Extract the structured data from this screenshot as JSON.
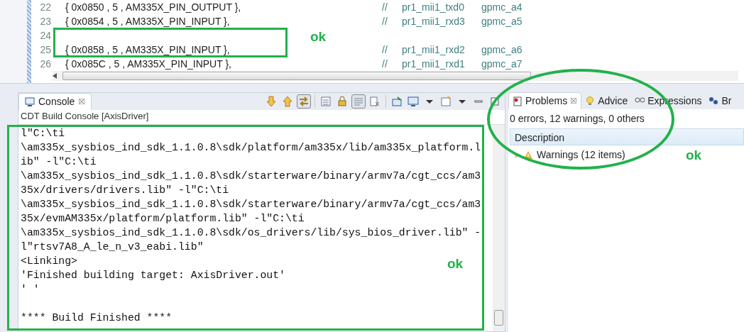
{
  "editor": {
    "lines": [
      {
        "number": "22",
        "code": "{ 0x0850 , 5 , AM335X_PIN_OUTPUT },",
        "comment": "//",
        "signal": "pr1_mii1_txd0",
        "pin": "gpmc_a4"
      },
      {
        "number": "23",
        "code": "{ 0x0854 , 5 , AM335X_PIN_INPUT },",
        "comment": "//",
        "signal": "pr1_mii1_rxd3",
        "pin": "gpmc_a5"
      },
      {
        "number": "24"
      },
      {
        "number": "25",
        "code": "{ 0x0858 , 5 , AM335X_PIN_INPUT },",
        "comment": "//",
        "signal": "pr1_mii1_rxd2",
        "pin": "gpmc_a6"
      },
      {
        "number": "26",
        "code": "{ 0x085C , 5 , AM335X_PIN_INPUT },",
        "comment": "//",
        "signal": "pr1_mii1_rxd1",
        "pin": "gpmc_a7"
      }
    ]
  },
  "console": {
    "tab": {
      "label": "Console",
      "selected": true,
      "close": "☒"
    },
    "toolbar": [
      {
        "kind": "down",
        "pressed": false
      },
      {
        "kind": "up",
        "pressed": false
      },
      {
        "kind": "link",
        "pressed": true
      },
      {
        "kind": "sep"
      },
      {
        "kind": "page",
        "pressed": false
      },
      {
        "kind": "lock",
        "pressed": false
      },
      {
        "kind": "lines",
        "pressed": true
      },
      {
        "kind": "clear",
        "pressed": false
      },
      {
        "kind": "sep"
      },
      {
        "kind": "pin",
        "pressed": false
      },
      {
        "kind": "monitor",
        "pressed": false
      },
      {
        "kind": "caret",
        "pressed": false
      },
      {
        "kind": "window",
        "pressed": false
      },
      {
        "kind": "caret",
        "pressed": false
      },
      {
        "kind": "min",
        "pressed": false
      },
      {
        "kind": "max",
        "pressed": false
      }
    ],
    "title": "CDT Build Console [AxisDriver]",
    "lines": [
      "l\"C:\\ti",
      "\\am335x_sysbios_ind_sdk_1.1.0.8\\sdk/platform/am335x/lib/am335x_platform.l",
      "ib\" -l\"C:\\ti",
      "\\am335x_sysbios_ind_sdk_1.1.0.8\\sdk/starterware/binary/armv7a/cgt_ccs/am3",
      "35x/drivers/drivers.lib\" -l\"C:\\ti",
      "\\am335x_sysbios_ind_sdk_1.1.0.8\\sdk/starterware/binary/armv7a/cgt_ccs/am3",
      "35x/evmAM335x/platform/platform.lib\" -l\"C:\\ti",
      "\\am335x_sysbios_ind_sdk_1.1.0.8\\sdk/os_drivers/lib/sys_bios_driver.lib\" -",
      "l\"rtsv7A8_A_le_n_v3_eabi.lib\"",
      "<Linking>",
      "'Finished building target: AxisDriver.out'",
      "' '"
    ],
    "footer": "**** Build Finished ****"
  },
  "problems": {
    "tabs": [
      {
        "label": "Problems",
        "kind": "problems",
        "selected": true,
        "close": "☒"
      },
      {
        "label": "Advice",
        "kind": "advice",
        "selected": false
      },
      {
        "label": "Expressions",
        "kind": "expressions",
        "selected": false
      },
      {
        "label": "Br",
        "kind": "breakpoints",
        "selected": false
      }
    ],
    "summary": "0 errors, 12 warnings, 0 others",
    "column": "Description",
    "rows": [
      {
        "label": "Warnings (12 items)",
        "expanded": false
      }
    ]
  },
  "annotations": [
    {
      "kind": "rect"
    },
    {
      "kind": "rect"
    },
    {
      "kind": "ellipse"
    },
    {
      "kind": "text",
      "text": "ok"
    },
    {
      "kind": "text",
      "text": "ok"
    },
    {
      "kind": "text",
      "text": "ok"
    }
  ]
}
